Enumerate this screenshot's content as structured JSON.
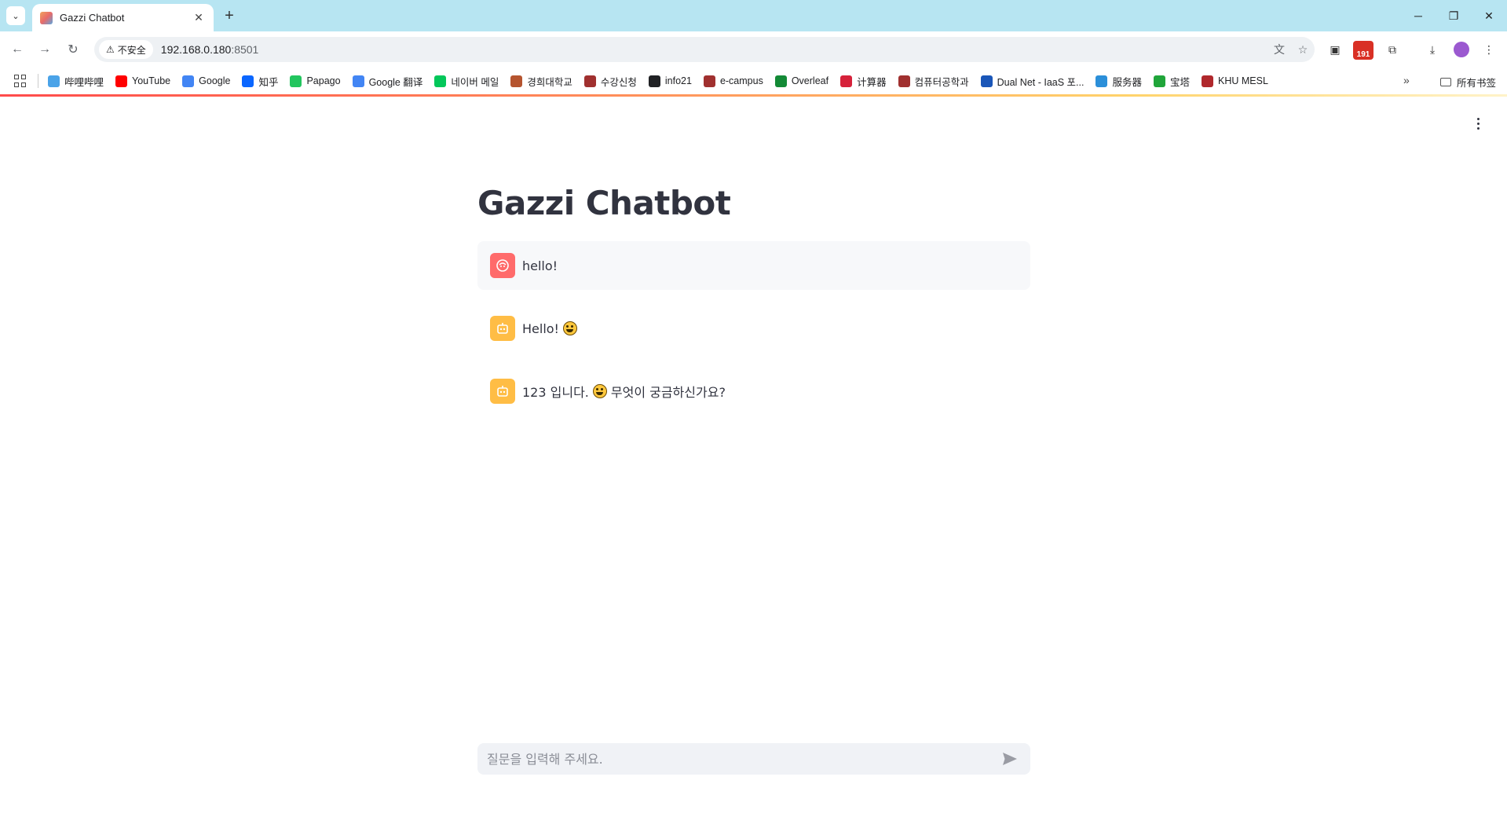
{
  "browser": {
    "tab_title": "Gazzi Chatbot",
    "security_label": "不安全",
    "url_host": "192.168.0.180",
    "url_port": ":8501",
    "extension_badge": "191"
  },
  "bookmarks": [
    {
      "label": "哔哩哔哩",
      "icon": "bilibili-icon",
      "color": "#4aa3e8"
    },
    {
      "label": "YouTube",
      "icon": "youtube-icon",
      "color": "#ff0000"
    },
    {
      "label": "Google",
      "icon": "google-icon",
      "color": "#4285f4"
    },
    {
      "label": "知乎",
      "icon": "zhihu-icon",
      "color": "#0a66ff"
    },
    {
      "label": "Papago",
      "icon": "papago-icon",
      "color": "#22c55e"
    },
    {
      "label": "Google 翻译",
      "icon": "google-translate-icon",
      "color": "#4285f4"
    },
    {
      "label": "네이버 메일",
      "icon": "naver-mail-icon",
      "color": "#03c75a"
    },
    {
      "label": "경희대학교",
      "icon": "khu-icon",
      "color": "#b5542f"
    },
    {
      "label": "수강신청",
      "icon": "khu-icon",
      "color": "#a0302f"
    },
    {
      "label": "info21",
      "icon": "globe-icon",
      "color": "#202124"
    },
    {
      "label": "e-campus",
      "icon": "khu-icon",
      "color": "#a0302f"
    },
    {
      "label": "Overleaf",
      "icon": "overleaf-icon",
      "color": "#138a36"
    },
    {
      "label": "计算器",
      "icon": "symbolab-icon",
      "color": "#d6213a"
    },
    {
      "label": "컴퓨터공학과",
      "icon": "khu-icon",
      "color": "#a0302f"
    },
    {
      "label": "Dual Net - IaaS 포...",
      "icon": "dualnet-icon",
      "color": "#1a56b8"
    },
    {
      "label": "服务器",
      "icon": "cloud-icon",
      "color": "#2b8fd9"
    },
    {
      "label": "宝塔",
      "icon": "baota-icon",
      "color": "#20a53a"
    },
    {
      "label": "KHU MESL",
      "icon": "mesl-icon",
      "color": "#b0282c"
    }
  ],
  "bookmarks_all_label": "所有书签",
  "app": {
    "title": "Gazzi Chatbot",
    "messages": [
      {
        "role": "user",
        "text": "hello!"
      },
      {
        "role": "assistant",
        "text": "Hello!",
        "emoji": "grinning-face-emoji"
      },
      {
        "role": "assistant",
        "text_before": "123 입니다.",
        "emoji": "smiling-face-emoji",
        "text_after": "무엇이 궁금하신가요?"
      }
    ],
    "input_placeholder": "질문을 입력해 주세요."
  }
}
